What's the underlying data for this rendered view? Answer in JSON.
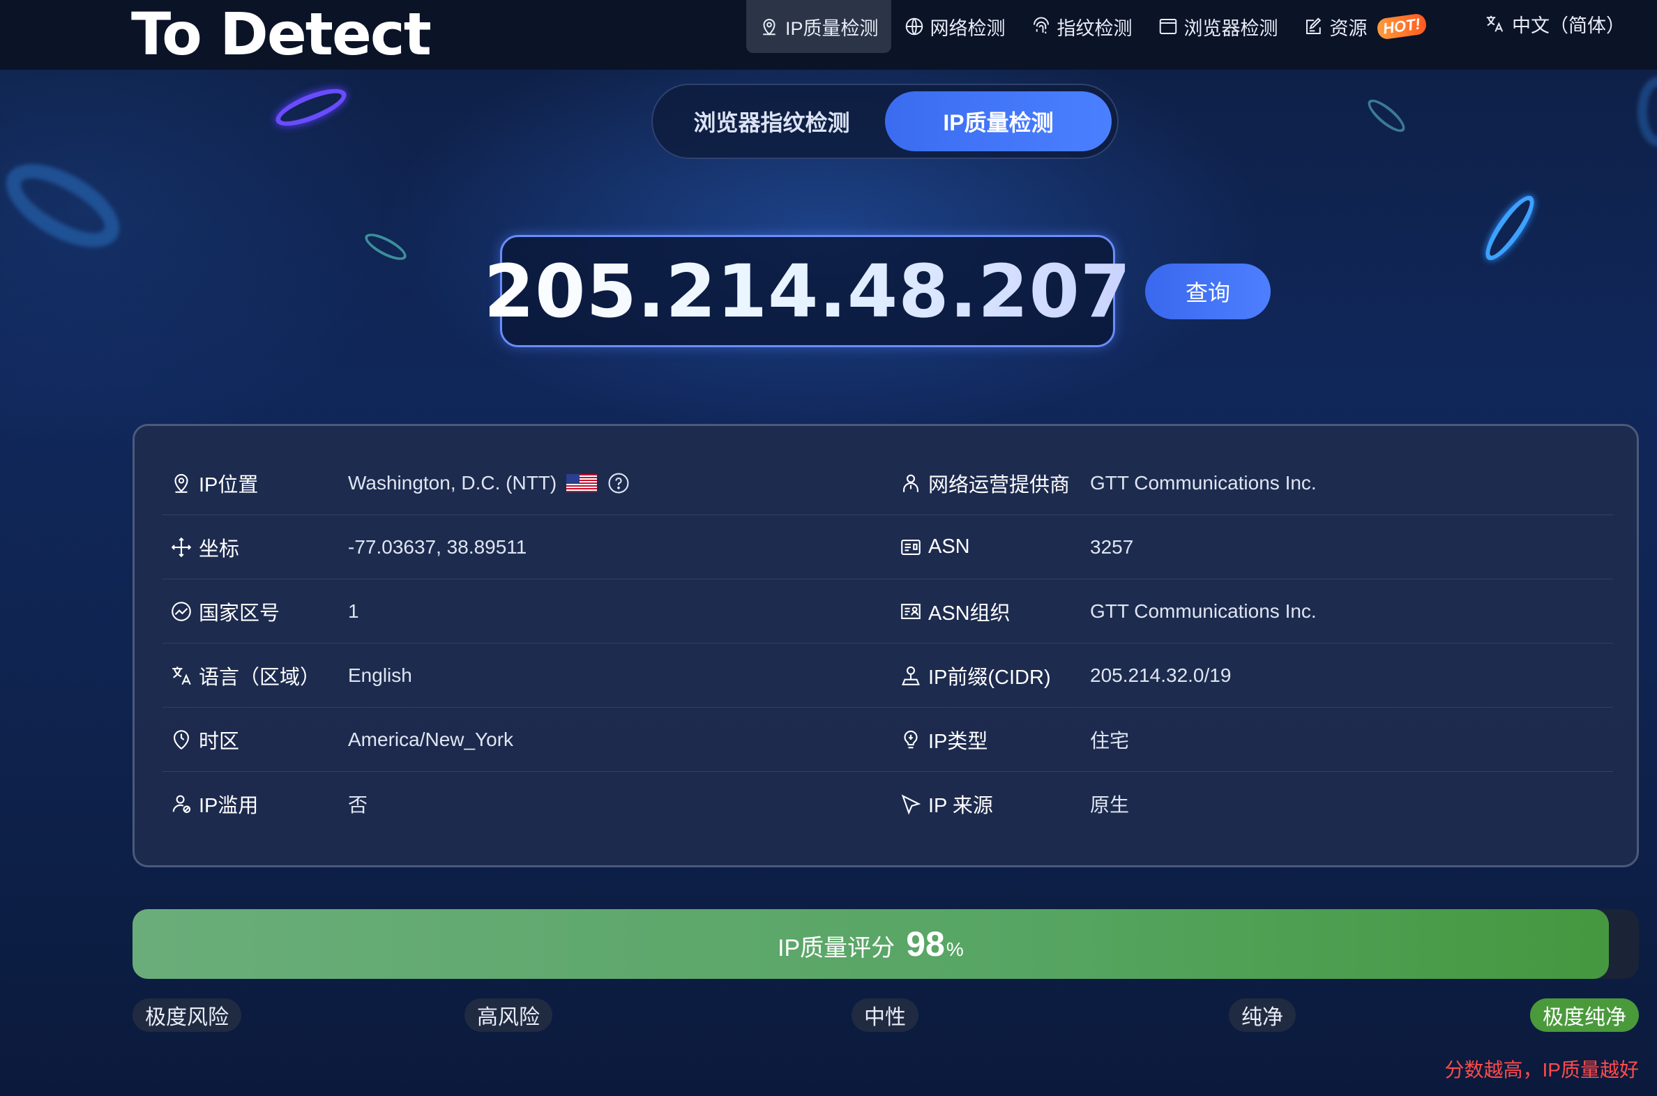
{
  "header": {
    "logo_text": "To Detect",
    "nav": [
      {
        "label": "IP质量检测",
        "icon": "location-pin-icon",
        "active": true
      },
      {
        "label": "网络检测",
        "icon": "globe-icon",
        "active": false
      },
      {
        "label": "指纹检测",
        "icon": "fingerprint-icon",
        "active": false
      },
      {
        "label": "浏览器检测",
        "icon": "browser-window-icon",
        "active": false
      },
      {
        "label": "资源",
        "icon": "edit-document-icon",
        "active": false,
        "badge": "HOT!"
      }
    ],
    "language": {
      "label": "中文（简体）",
      "icon": "translate-icon"
    }
  },
  "mode_switch": {
    "tabs": [
      {
        "label": "浏览器指纹检测",
        "active": false
      },
      {
        "label": "IP质量检测",
        "active": true
      }
    ]
  },
  "search": {
    "ip": "205.214.48.207",
    "button_label": "查询"
  },
  "info": {
    "left": [
      {
        "label": "IP位置",
        "value": "Washington, D.C. (NTT)",
        "icon": "location-pin-icon",
        "flag": "us-flag-icon",
        "help_icon": "question-circle-icon"
      },
      {
        "label": "坐标",
        "value": "-77.03637, 38.89511",
        "icon": "coordinates-move-icon"
      },
      {
        "label": "国家区号",
        "value": "1",
        "icon": "dashboard-gauge-icon"
      },
      {
        "label": "语言（区域）",
        "value": "English",
        "icon": "translate-icon"
      },
      {
        "label": "时区",
        "value": "America/New_York",
        "icon": "clock-icon"
      },
      {
        "label": "IP滥用",
        "value": "否",
        "icon": "user-abuse-icon"
      }
    ],
    "right": [
      {
        "label": "网络运营提供商",
        "value": "GTT Communications Inc.",
        "icon": "person-icon"
      },
      {
        "label": "ASN",
        "value": "3257",
        "icon": "id-card-icon"
      },
      {
        "label": "ASN组织",
        "value": "GTT Communications Inc.",
        "icon": "organization-card-icon"
      },
      {
        "label": "IP前缀(CIDR)",
        "value": "205.214.32.0/19",
        "icon": "user-pin-icon"
      },
      {
        "label": "IP类型",
        "value": "住宅",
        "icon": "lightbulb-icon"
      },
      {
        "label": "IP 来源",
        "value": "原生",
        "icon": "cursor-arrow-icon"
      }
    ]
  },
  "score": {
    "label": "IP质量评分",
    "value": "98",
    "unit": "%",
    "fraction": 0.98,
    "levels": [
      "极度风险",
      "高风险",
      "中性",
      "纯净",
      "极度纯净"
    ],
    "active_level": "极度纯净",
    "hint": "分数越高，IP质量越好"
  },
  "colors": {
    "accent_blue": "#4a80ff",
    "score_green": "#4a9a3c",
    "hint_red": "#ff4b4b",
    "hot_badge": "#ff6a2a"
  }
}
